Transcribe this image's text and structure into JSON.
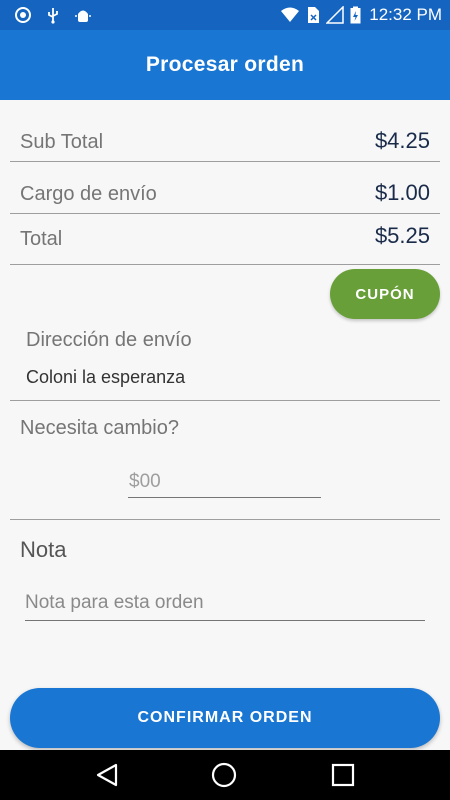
{
  "status_bar": {
    "time": "12:32 PM",
    "left_icons": [
      "sync-icon",
      "usb-icon",
      "android-debug-icon"
    ],
    "right_icons": [
      "wifi-icon",
      "sim-icon",
      "signal-icon",
      "battery-charging-icon"
    ]
  },
  "app_bar": {
    "title": "Procesar orden"
  },
  "summary": {
    "subtotal_label": "Sub Total",
    "subtotal_value": "$4.25",
    "shipping_label": "Cargo de envío",
    "shipping_value": "$1.00",
    "total_label": "Total",
    "total_value": "$5.25"
  },
  "coupon_button": {
    "label": "CUPÓN",
    "color": "#689f38"
  },
  "address": {
    "label": "Dirección de envío",
    "value": "Coloni la esperanza"
  },
  "change": {
    "label": "Necesita cambio?",
    "placeholder": "$00"
  },
  "note": {
    "heading": "Nota",
    "placeholder": "Nota para esta orden"
  },
  "confirm_button": {
    "label": "CONFIRMAR ORDEN",
    "color": "#1976d2"
  },
  "nav_bar": {
    "icons": [
      "back-icon",
      "home-icon",
      "recents-icon"
    ]
  },
  "colors": {
    "status_bar": "#1565c0",
    "app_bar": "#1976d2",
    "background": "#f7f7f7"
  }
}
